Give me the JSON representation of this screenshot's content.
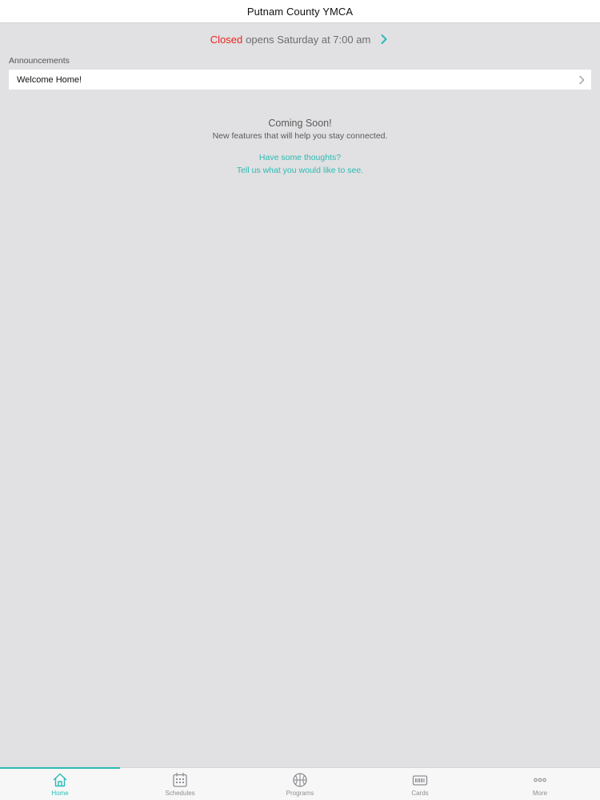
{
  "app": {
    "title": "Putnam County YMCA"
  },
  "status": {
    "state": "Closed",
    "detail": "opens Saturday at 7:00 am"
  },
  "announcements": {
    "header": "Announcements",
    "items": [
      {
        "label": "Welcome Home!"
      }
    ]
  },
  "coming_soon": {
    "title": "Coming Soon!",
    "subtitle": "New features that will help you stay connected.",
    "link_line1": "Have some thoughts?",
    "link_line2": "Tell us what you would like to see."
  },
  "tabs": [
    {
      "label": "Home",
      "icon": "home-icon",
      "active": true
    },
    {
      "label": "Schedules",
      "icon": "calendar-icon",
      "active": false
    },
    {
      "label": "Programs",
      "icon": "basketball-icon",
      "active": false
    },
    {
      "label": "Cards",
      "icon": "card-icon",
      "active": false
    },
    {
      "label": "More",
      "icon": "more-icon",
      "active": false
    }
  ],
  "colors": {
    "accent": "#2bbcb4",
    "closed": "#e8251f",
    "background": "#e1e0e2",
    "inactive_tab": "#8e8e93"
  }
}
